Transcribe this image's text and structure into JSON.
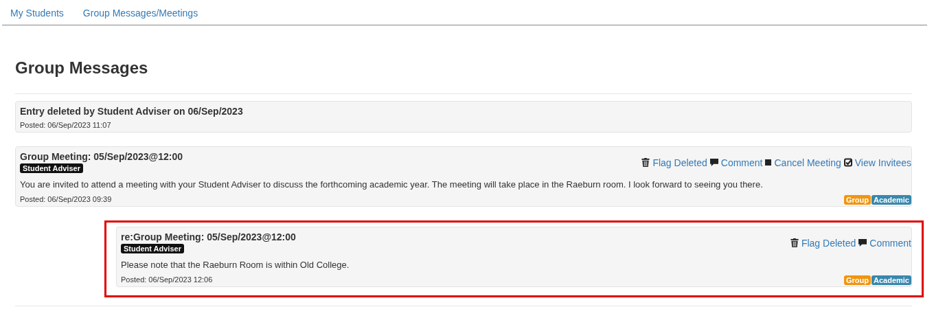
{
  "tabs": [
    {
      "label": "My Students"
    },
    {
      "label": "Group Messages/Meetings"
    }
  ],
  "heading": "Group Messages",
  "messages": [
    {
      "kind": "deleted",
      "title": "Entry deleted by Student Adviser on 06/Sep/2023",
      "posted": "Posted: 06/Sep/2023 11:07"
    },
    {
      "kind": "post",
      "title": "Group Meeting: 05/Sep/2023@12:00",
      "author": "Student Adviser",
      "body": "You are invited to attend a meeting with your Student Adviser to discuss the forthcoming academic year. The meeting will take place in the Raeburn room. I look forward to seeing you there.",
      "posted": "Posted: 06/Sep/2023 09:39",
      "actions": [
        {
          "kind": "trash",
          "label": "Flag Deleted"
        },
        {
          "kind": "comment",
          "label": "Comment"
        },
        {
          "kind": "stop",
          "label": "Cancel Meeting"
        },
        {
          "kind": "check",
          "label": "View Invitees"
        }
      ],
      "tags": [
        {
          "label": "Group",
          "color": "#f0960f"
        },
        {
          "label": "Academic",
          "color": "#3a87ad"
        }
      ],
      "children": [
        {
          "kind": "post",
          "highlighted": true,
          "title": "re:Group Meeting: 05/Sep/2023@12:00",
          "author": "Student Adviser",
          "body": "Please note that the Raeburn Room is within Old College.",
          "posted": "Posted: 06/Sep/2023 12:06",
          "actions": [
            {
              "kind": "trash",
              "label": "Flag Deleted"
            },
            {
              "kind": "comment",
              "label": "Comment"
            }
          ],
          "tags": [
            {
              "label": "Group",
              "color": "#f0960f"
            },
            {
              "label": "Academic",
              "color": "#3a87ad"
            }
          ]
        }
      ]
    }
  ]
}
